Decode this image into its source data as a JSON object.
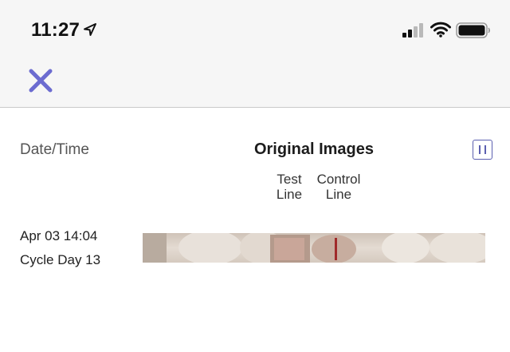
{
  "status_bar": {
    "time": "11:27",
    "location_icon": "location-arrow-icon",
    "signal_icon": "cellular-signal-icon",
    "wifi_icon": "wifi-icon",
    "battery_icon": "battery-icon"
  },
  "nav": {
    "close_icon": "close-icon",
    "accent_color": "#6b6bd0"
  },
  "table": {
    "header": {
      "date_time": "Date/Time",
      "original_images": "Original Images",
      "pause_icon": "pause-icon"
    },
    "subheaders": {
      "test_line_1": "Test",
      "test_line_2": "Line",
      "control_line_1": "Control",
      "control_line_2": "Line"
    },
    "rows": [
      {
        "date": "Apr 03 14:04",
        "cycle_day": "Cycle Day 13",
        "image": "test-strip-image"
      }
    ]
  }
}
